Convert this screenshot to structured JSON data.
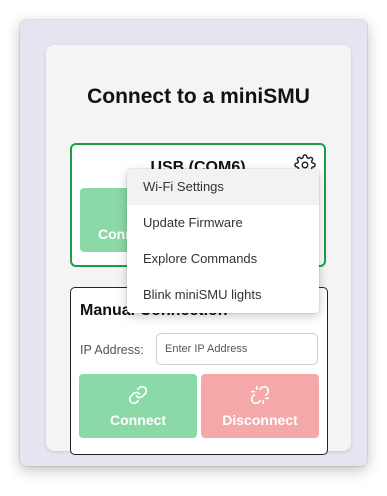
{
  "page": {
    "title": "Connect to a miniSMU"
  },
  "usb_card": {
    "title": "USB (COM6)",
    "connect_label": "Connect",
    "settings_icon": "gear-icon",
    "accent_color": "#19a046"
  },
  "manual_card": {
    "title": "Manual Connection",
    "ip_label": "IP Address:",
    "ip_placeholder": "Enter IP Address",
    "ip_value": "",
    "connect_label": "Connect",
    "connect_icon": "link-icon",
    "disconnect_label": "Disconnect",
    "disconnect_icon": "unlink-icon",
    "connect_color": "#8ad9a6",
    "disconnect_color": "#f4a8a8"
  },
  "settings_menu": {
    "items": [
      {
        "label": "Wi-Fi Settings",
        "active": true
      },
      {
        "label": "Update Firmware"
      },
      {
        "label": "Explore Commands"
      },
      {
        "label": "Blink miniSMU lights"
      }
    ]
  }
}
